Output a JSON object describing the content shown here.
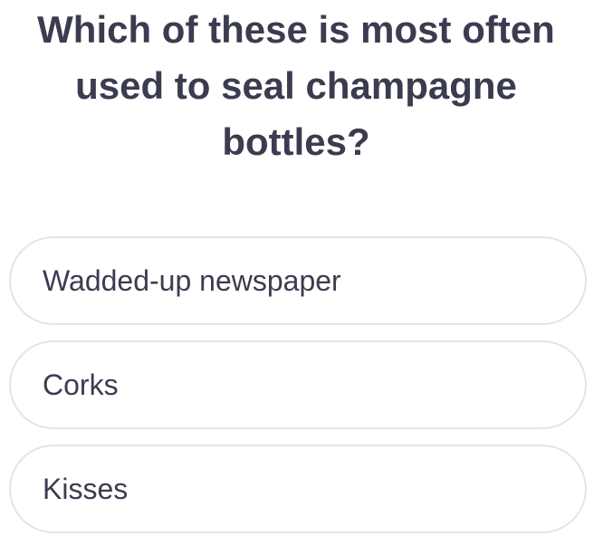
{
  "question": {
    "text": "Which of these is most often used to seal champagne bottles?"
  },
  "answers": [
    {
      "label": "Wadded-up newspaper"
    },
    {
      "label": "Corks"
    },
    {
      "label": "Kisses"
    }
  ]
}
